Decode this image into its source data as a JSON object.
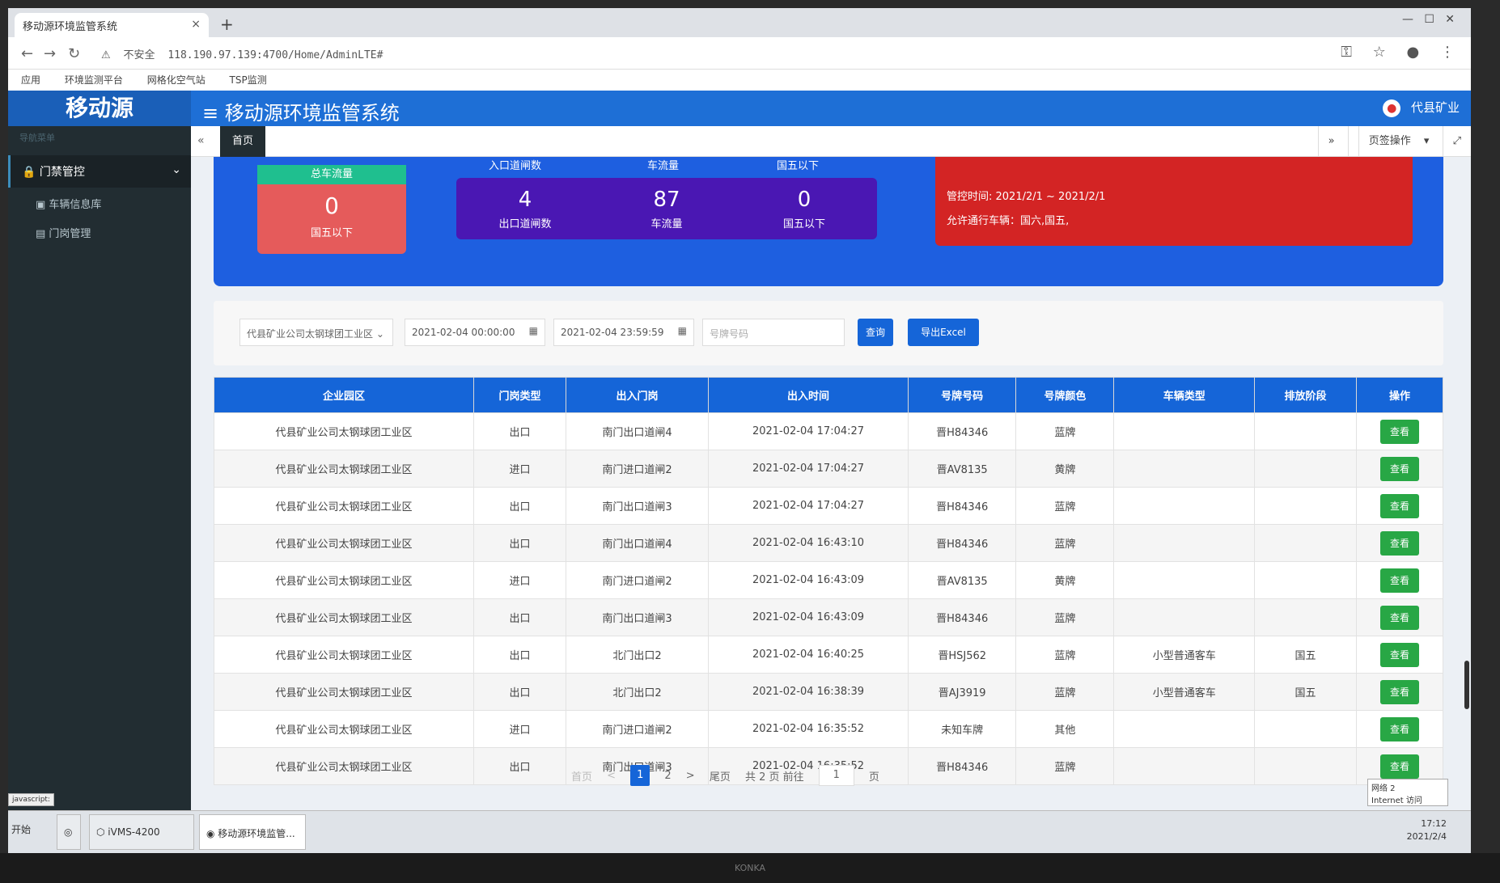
{
  "browser": {
    "tab_title": "移动源环境监管系统",
    "url_warning": "不安全",
    "url": "118.190.97.139:4700/Home/AdminLTE#",
    "bookmarks": [
      "应用",
      "环境监测平台",
      "网格化空气站",
      "TSP监测"
    ]
  },
  "app": {
    "logo": "移动源",
    "title": "移动源环境监管系统",
    "user": "代县矿业",
    "sidebar": {
      "heading": "导航菜单",
      "menu": "门禁管控",
      "items": [
        "车辆信息库",
        "门岗管理"
      ]
    },
    "tabs": {
      "home": "首页",
      "page_ops": "页签操作"
    },
    "stats": {
      "total_header": "总车流量",
      "total_value": "0",
      "total_label": "国五以下",
      "entry_labels": [
        "入口道闸数",
        "车流量",
        "国五以下"
      ],
      "exit": [
        {
          "value": "4",
          "label": "出口道闸数"
        },
        {
          "value": "87",
          "label": "车流量"
        },
        {
          "value": "0",
          "label": "国五以下"
        }
      ]
    },
    "alert": {
      "time": "管控时间: 2021/2/1 ~ 2021/2/1",
      "allow": "允许通行车辆：国六,国五,"
    },
    "filter": {
      "company": "代县矿业公司太钢球团工业区",
      "start": "2021-02-04 00:00:00",
      "end": "2021-02-04 23:59:59",
      "plate_placeholder": "号牌号码",
      "query": "查询",
      "export": "导出Excel"
    },
    "table": {
      "headers": [
        "企业园区",
        "门岗类型",
        "出入门岗",
        "出入时间",
        "号牌号码",
        "号牌颜色",
        "车辆类型",
        "排放阶段",
        "操作"
      ],
      "rows": [
        [
          "代县矿业公司太钢球团工业区",
          "出口",
          "南门出口道闸4",
          "2021-02-04 17:04:27",
          "晋H84346",
          "蓝牌",
          "",
          "",
          "查看"
        ],
        [
          "代县矿业公司太钢球团工业区",
          "进口",
          "南门进口道闸2",
          "2021-02-04 17:04:27",
          "晋AV8135",
          "黄牌",
          "",
          "",
          "查看"
        ],
        [
          "代县矿业公司太钢球团工业区",
          "出口",
          "南门出口道闸3",
          "2021-02-04 17:04:27",
          "晋H84346",
          "蓝牌",
          "",
          "",
          "查看"
        ],
        [
          "代县矿业公司太钢球团工业区",
          "出口",
          "南门出口道闸4",
          "2021-02-04 16:43:10",
          "晋H84346",
          "蓝牌",
          "",
          "",
          "查看"
        ],
        [
          "代县矿业公司太钢球团工业区",
          "进口",
          "南门进口道闸2",
          "2021-02-04 16:43:09",
          "晋AV8135",
          "黄牌",
          "",
          "",
          "查看"
        ],
        [
          "代县矿业公司太钢球团工业区",
          "出口",
          "南门出口道闸3",
          "2021-02-04 16:43:09",
          "晋H84346",
          "蓝牌",
          "",
          "",
          "查看"
        ],
        [
          "代县矿业公司太钢球团工业区",
          "出口",
          "北门出口2",
          "2021-02-04 16:40:25",
          "晋HSJ562",
          "蓝牌",
          "小型普通客车",
          "国五",
          "查看"
        ],
        [
          "代县矿业公司太钢球团工业区",
          "出口",
          "北门出口2",
          "2021-02-04 16:38:39",
          "晋AJ3919",
          "蓝牌",
          "小型普通客车",
          "国五",
          "查看"
        ],
        [
          "代县矿业公司太钢球团工业区",
          "进口",
          "南门进口道闸2",
          "2021-02-04 16:35:52",
          "未知车牌",
          "其他",
          "",
          "",
          "查看"
        ],
        [
          "代县矿业公司太钢球团工业区",
          "出口",
          "南门出口道闸3",
          "2021-02-04 16:35:52",
          "晋H84346",
          "蓝牌",
          "",
          "",
          "查看"
        ]
      ]
    },
    "pager": {
      "first": "首页",
      "prev": "<",
      "pages": [
        "1",
        "2"
      ],
      "next": ">",
      "last": "尾页",
      "total": "共 2 页 前往",
      "goto": "1",
      "suffix": "页"
    }
  },
  "taskbar": {
    "start": "开始",
    "items": [
      "iVMS-4200",
      "移动源环境监管..."
    ],
    "clock_time": "17:12",
    "clock_date": "2021/2/4",
    "net": "网络 2",
    "net_sub": "Internet 访问",
    "status": "javascript:"
  },
  "monitor_brand": "KONKA"
}
